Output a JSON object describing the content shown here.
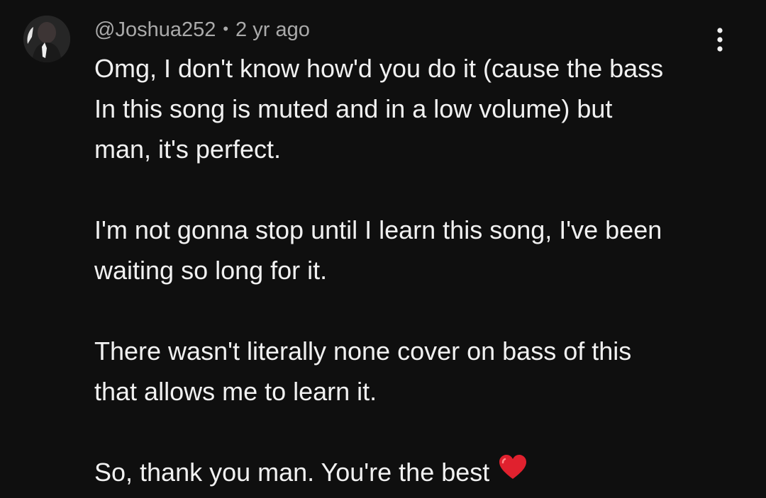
{
  "comment": {
    "author": "@Joshua252",
    "separator": "•",
    "timestamp": "2 yr ago",
    "paragraphs": [
      [
        "Omg, I don't know how'd you do it (cause the bass",
        "In this song is muted and in a low volume) but",
        "man, it's perfect."
      ],
      [
        "I'm not gonna stop until I learn this song, I've been",
        "waiting so long for it."
      ],
      [
        "There wasn't literally none cover on bass of this",
        "that allows me to learn it."
      ],
      [
        "So, thank you man. You're the best"
      ]
    ],
    "trailing_emoji": "red-heart-icon",
    "menu_icon": "more-vertical-icon"
  },
  "colors": {
    "background": "#0f0f0f",
    "text": "#f1f1f1",
    "meta": "#aaaaaa",
    "heart": "#e0212e"
  }
}
